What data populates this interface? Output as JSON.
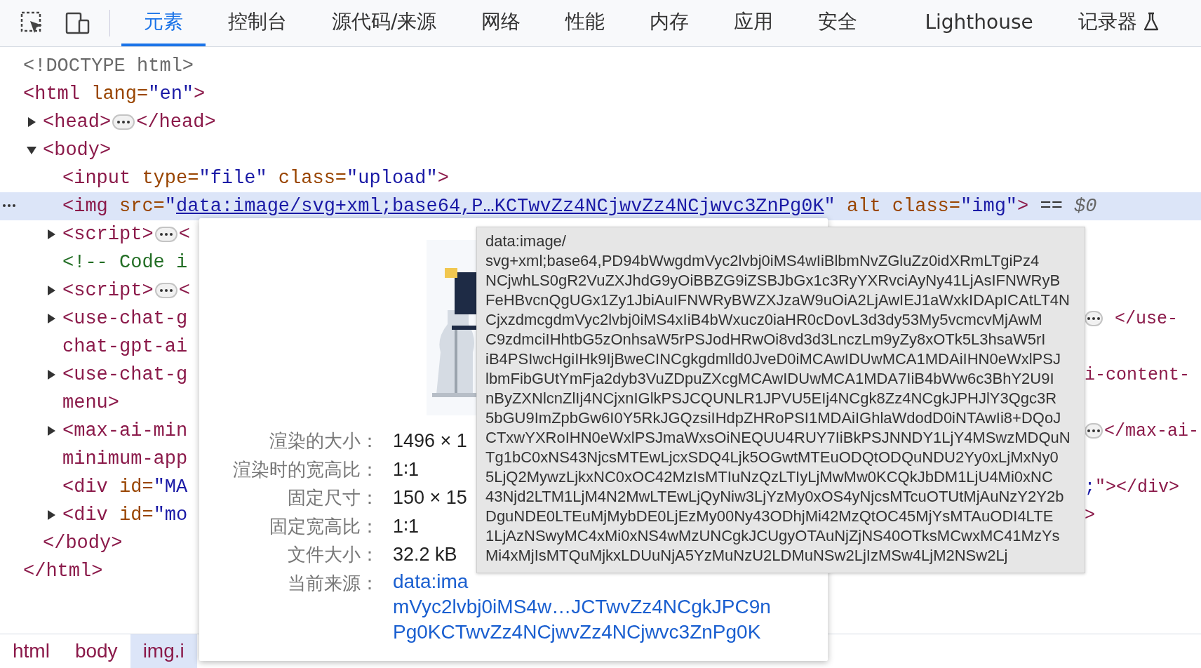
{
  "toolbar": {
    "tabs": [
      {
        "label": "元素",
        "selected": true
      },
      {
        "label": "控制台",
        "selected": false
      },
      {
        "label": "源代码/来源",
        "selected": false
      },
      {
        "label": "网络",
        "selected": false
      },
      {
        "label": "性能",
        "selected": false
      },
      {
        "label": "内存",
        "selected": false
      },
      {
        "label": "应用",
        "selected": false
      },
      {
        "label": "安全",
        "selected": false
      },
      {
        "label": "Lighthouse",
        "selected": false
      },
      {
        "label": "记录器",
        "selected": false,
        "kind": "experimental"
      }
    ]
  },
  "tree": [
    {
      "selected": false,
      "lines": [
        {
          "parts": [
            {
              "kind": "doctype",
              "text": "<!DOCTYPE html>"
            }
          ]
        }
      ]
    },
    {
      "selected": false,
      "lines": [
        {
          "parts": [
            {
              "kind": "tag",
              "text": "<html"
            },
            {
              "kind": "attr",
              "text": " lang="
            },
            {
              "kind": "value",
              "text": "\"en\""
            },
            {
              "kind": "tag",
              "text": ">"
            }
          ]
        }
      ],
      "children": [
        {
          "selected": false,
          "expanded": false,
          "lines": [
            {
              "parts": [
                {
                  "kind": "tag",
                  "text": "<head>"
                },
                {
                  "kind": "ellipsis"
                },
                {
                  "kind": "tag",
                  "text": "</head>"
                }
              ]
            }
          ]
        },
        {
          "selected": false,
          "expanded": true,
          "lines": [
            {
              "parts": [
                {
                  "kind": "tag",
                  "text": "<body>"
                }
              ]
            }
          ],
          "children": [
            {
              "selected": false,
              "lines": [
                {
                  "parts": [
                    {
                      "kind": "tag",
                      "text": "<input"
                    },
                    {
                      "kind": "attr",
                      "text": " type="
                    },
                    {
                      "kind": "value",
                      "text": "\"file\""
                    },
                    {
                      "kind": "attr",
                      "text": " class="
                    },
                    {
                      "kind": "value",
                      "text": "\"upload\""
                    },
                    {
                      "kind": "tag",
                      "text": ">"
                    }
                  ]
                }
              ]
            },
            {
              "selected": true,
              "lines": [
                {
                  "parts": [
                    {
                      "kind": "tag",
                      "text": "<img"
                    },
                    {
                      "kind": "attr",
                      "text": " src="
                    },
                    {
                      "kind": "value",
                      "text": "\""
                    },
                    {
                      "kind": "link",
                      "text": "data:image/svg+xml;base64,P…KCTwvZz4NCjwvZz4NCjwvc3ZnPg0K"
                    },
                    {
                      "kind": "value",
                      "text": "\""
                    },
                    {
                      "kind": "attr",
                      "text": " alt class="
                    },
                    {
                      "kind": "value",
                      "text": "\"img\""
                    },
                    {
                      "kind": "tag",
                      "text": ">"
                    },
                    {
                      "kind": "plain",
                      "text": " == "
                    },
                    {
                      "kind": "ref",
                      "text": "$0"
                    }
                  ]
                }
              ]
            },
            {
              "selected": false,
              "expanded": false,
              "lines": [
                {
                  "parts": [
                    {
                      "kind": "tag",
                      "text": "<script>"
                    },
                    {
                      "kind": "ellipsis"
                    },
                    {
                      "kind": "tag",
                      "text": "<"
                    }
                  ]
                }
              ]
            },
            {
              "selected": false,
              "lines": [
                {
                  "parts": [
                    {
                      "kind": "comment",
                      "text": "<!-- Code i"
                    }
                  ]
                }
              ]
            },
            {
              "selected": false,
              "expanded": false,
              "lines": [
                {
                  "parts": [
                    {
                      "kind": "tag",
                      "text": "<script>"
                    },
                    {
                      "kind": "ellipsis"
                    },
                    {
                      "kind": "tag",
                      "text": "<"
                    }
                  ]
                }
              ]
            },
            {
              "selected": false,
              "expanded": false,
              "lines": [
                {
                  "parts": [
                    {
                      "kind": "tag",
                      "text": "<use-chat-g"
                    }
                  ],
                  "tail": [
                    {
                      "kind": "ellipsis"
                    },
                    {
                      "kind": "tag",
                      "text": " </use-"
                    }
                  ]
                },
                {
                  "parts": [
                    {
                      "kind": "tag",
                      "text": "chat-gpt-ai"
                    }
                  ]
                }
              ]
            },
            {
              "selected": false,
              "expanded": false,
              "lines": [
                {
                  "parts": [
                    {
                      "kind": "tag",
                      "text": "<use-chat-g"
                    }
                  ],
                  "tail": [
                    {
                      "kind": "tag",
                      "text": "i-content-"
                    }
                  ]
                },
                {
                  "parts": [
                    {
                      "kind": "tag",
                      "text": "menu>"
                    }
                  ]
                }
              ]
            },
            {
              "selected": false,
              "expanded": false,
              "lines": [
                {
                  "parts": [
                    {
                      "kind": "tag",
                      "text": "<max-ai-min"
                    }
                  ],
                  "tail": [
                    {
                      "kind": "ellipsis"
                    },
                    {
                      "kind": "tag",
                      "text": "</max-ai-"
                    }
                  ]
                },
                {
                  "parts": [
                    {
                      "kind": "tag",
                      "text": "minimum-app"
                    }
                  ]
                }
              ]
            },
            {
              "selected": false,
              "lines": [
                {
                  "parts": [
                    {
                      "kind": "tag",
                      "text": "<div"
                    },
                    {
                      "kind": "attr",
                      "text": " id="
                    },
                    {
                      "kind": "value",
                      "text": "\"MA"
                    }
                  ],
                  "tail": [
                    {
                      "kind": "value",
                      "text": ";"
                    },
                    {
                      "kind": "tag",
                      "text": "\"></div>"
                    }
                  ]
                }
              ]
            },
            {
              "selected": false,
              "expanded": false,
              "lines": [
                {
                  "parts": [
                    {
                      "kind": "tag",
                      "text": "<div"
                    },
                    {
                      "kind": "attr",
                      "text": " id="
                    },
                    {
                      "kind": "value",
                      "text": "\"mo"
                    }
                  ],
                  "tail": [
                    {
                      "kind": "tag",
                      "text": ">"
                    }
                  ]
                }
              ]
            }
          ]
        },
        {
          "selected": false,
          "lines": [
            {
              "parts": [
                {
                  "kind": "tag",
                  "text": "</body>"
                }
              ]
            }
          ]
        }
      ]
    },
    {
      "selected": false,
      "lines": [
        {
          "parts": [
            {
              "kind": "tag",
              "text": "</html>"
            }
          ]
        }
      ]
    }
  ],
  "breadcrumbs": [
    {
      "label": "html",
      "selected": false
    },
    {
      "label": "body",
      "selected": false
    },
    {
      "label": "img.i",
      "selected": true
    }
  ],
  "preview": {
    "details": [
      {
        "label": "渲染的大小：",
        "value": "1496 × 1"
      },
      {
        "label": "渲染时的宽高比：",
        "value": "1∶1"
      },
      {
        "label": "固定尺寸：",
        "value": "150 × 15"
      },
      {
        "label": "固定宽高比：",
        "value": "1∶1"
      },
      {
        "label": "文件大小：",
        "value": "32.2 kB"
      }
    ],
    "source": {
      "label": "当前来源：",
      "lines": [
        "data:ima",
        "mVyc2lvbj0iMS4w…JCTwvZz4NCgkJPC9n",
        "Pg0KCTwvZz4NCjwvZz4NCjwvc3ZnPg0K"
      ]
    }
  },
  "tooltip": {
    "lines": [
      "data:image/",
      "svg+xml;base64,PD94bWwgdmVyc2lvbj0iMS4wIiBlbmNvZGluZz0idXRmLTgiPz4",
      "NCjwhLS0gR2VuZXJhdG9yOiBBZG9iZSBJbGx1c3RyYXRvciAyNy41LjAsIFNWRyB",
      "FeHBvcnQgUGx1Zy1JbiAuIFNWRyBWZXJzaW9uOiA2LjAwIEJ1aWxkIDApICAtLT4N",
      "CjxzdmcgdmVyc2lvbj0iMS4xIiB4bWxucz0iaHR0cDovL3d3dy53My5vcmcvMjAwM",
      "C9zdmciIHhtbG5zOnhsaW5rPSJodHRwOi8vd3d3LnczLm9yZy8xOTk5L3hsaW5rI",
      "iB4PSIwcHgiIHk9IjBweCINCgkgdmlld0JveD0iMCAwIDUwMCA1MDAiIHN0eWxlPSJ",
      "lbmFibGUtYmFja2dyb3VuZDpuZXcgMCAwIDUwMCA1MDA7IiB4bWw6c3BhY2U9I",
      "nByZXNlcnZlIj4NCjxnIGlkPSJCQUNLR1JPVU5EIj4NCgk8Zz4NCgkJPHJlY3Qgc3R",
      "5bGU9ImZpbGw6I0Y5RkJGQzsiIHdpZHRoPSI1MDAiIGhlaWdodD0iNTAwIi8+DQoJ",
      "CTxwYXRoIHN0eWxlPSJmaWxsOiNEQUU4RUY7IiBkPSJNNDY1LjY4MSwzMDQuN",
      "Tg1bC0xNS43NjcsMTEwLjcxSDQ4Ljk5OGwtMTEuODQtODQuNDU2Yy0xLjMxNy0",
      "5LjQ2MywzLjkxNC0xOC42MzIsMTIuNzQzLTIyLjMwMw0KCQkJbDM1LjU4Mi0xNC",
      "43Njd2LTM1LjM4N2MwLTEwLjQyNiw3LjYzMy0xOS4yNjcsMTcuOTUtMjAuNzY2Y2b",
      "DguNDE0LTEuMjMybDE0LjEzMy00Ny43ODhjMi42MzQtOC45MjYsMTAuODI4LTE",
      "1LjAzNSwyMC4xMi0xNS4wMzUNCgkJCUgyOTAuNjZjNS40OTksMCwxMC41MzYs",
      "Mi4xMjIsMTQuMjkxLDUuNjA5YzMuNzU2LDMuNSw2LjIzMSw4LjM2NSw2Lj"
    ]
  }
}
